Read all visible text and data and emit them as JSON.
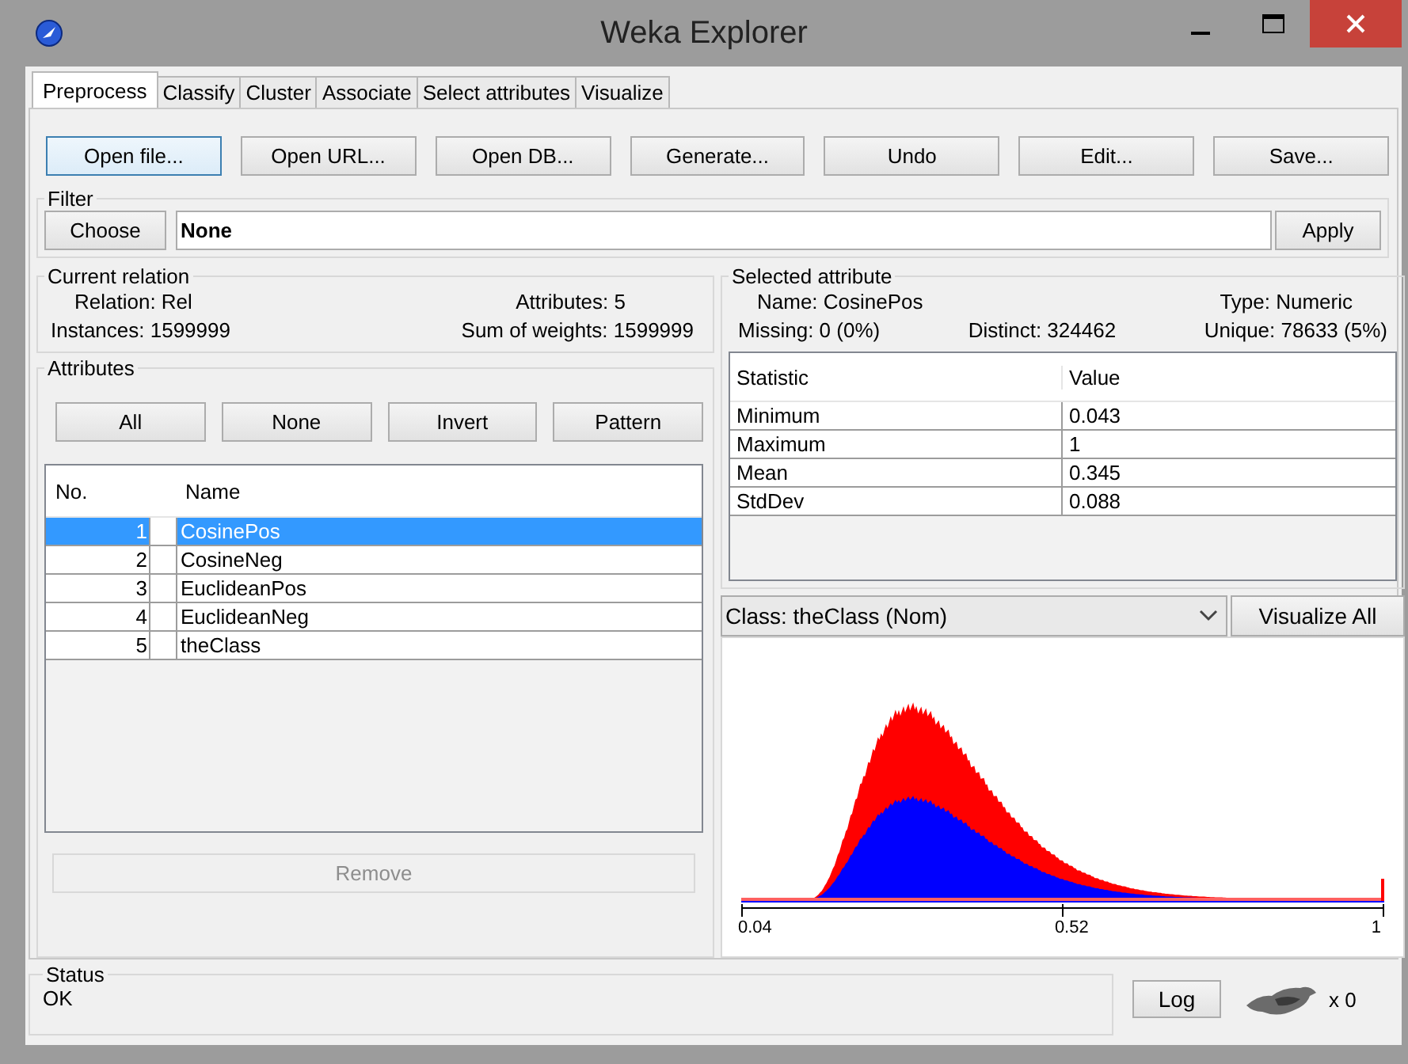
{
  "window": {
    "title": "Weka Explorer"
  },
  "tabs": [
    {
      "label": "Preprocess",
      "selected": true
    },
    {
      "label": "Classify",
      "selected": false
    },
    {
      "label": "Cluster",
      "selected": false
    },
    {
      "label": "Associate",
      "selected": false
    },
    {
      "label": "Select attributes",
      "selected": false
    },
    {
      "label": "Visualize",
      "selected": false
    }
  ],
  "toolbar": [
    {
      "label": "Open file...",
      "focused": true
    },
    {
      "label": "Open URL...",
      "focused": false
    },
    {
      "label": "Open DB...",
      "focused": false
    },
    {
      "label": "Generate...",
      "focused": false
    },
    {
      "label": "Undo",
      "focused": false
    },
    {
      "label": "Edit...",
      "focused": false
    },
    {
      "label": "Save...",
      "focused": false
    }
  ],
  "filter": {
    "title": "Filter",
    "choose": "Choose",
    "value": "None",
    "apply": "Apply"
  },
  "current_relation": {
    "title": "Current relation",
    "lines": [
      {
        "fields": [
          {
            "label": "Relation:",
            "value": "Rel"
          },
          {
            "label": "Attributes:",
            "value": "5"
          }
        ]
      },
      {
        "fields": [
          {
            "label": "Instances:",
            "value": "1599999"
          },
          {
            "label": "Sum of weights:",
            "value": "1599999"
          }
        ]
      }
    ]
  },
  "attributes": {
    "title": "Attributes",
    "buttons": [
      "All",
      "None",
      "Invert",
      "Pattern"
    ],
    "columns": [
      "No.",
      "Name"
    ],
    "rows": [
      {
        "no": "1",
        "name": "CosinePos",
        "selected": true,
        "checked": false
      },
      {
        "no": "2",
        "name": "CosineNeg",
        "selected": false,
        "checked": false
      },
      {
        "no": "3",
        "name": "EuclideanPos",
        "selected": false,
        "checked": false
      },
      {
        "no": "4",
        "name": "EuclideanNeg",
        "selected": false,
        "checked": false
      },
      {
        "no": "5",
        "name": "theClass",
        "selected": false,
        "checked": false
      }
    ],
    "remove": {
      "label": "Remove",
      "disabled": true
    }
  },
  "selected_attribute": {
    "title": "Selected attribute",
    "lines": [
      {
        "fields": [
          {
            "label": "Name:",
            "value": "CosinePos"
          },
          {
            "label": "Type:",
            "value": "Numeric"
          }
        ]
      },
      {
        "fields": [
          {
            "label": "Missing:",
            "value": "0 (0%)"
          },
          {
            "label": "Distinct:",
            "value": "324462"
          },
          {
            "label": "Unique:",
            "value": "78633 (5%)"
          }
        ]
      }
    ],
    "columns": [
      "Statistic",
      "Value"
    ],
    "stats": [
      {
        "statistic": "Minimum",
        "value": "0.043"
      },
      {
        "statistic": "Maximum",
        "value": "1"
      },
      {
        "statistic": "Mean",
        "value": "0.345"
      },
      {
        "statistic": "StdDev",
        "value": "0.088"
      }
    ]
  },
  "class_select": {
    "value": "Class: theClass (Nom)"
  },
  "visualize_all": "Visualize All",
  "histogram": {
    "ticks": [
      "0.04",
      "0.52",
      "1"
    ]
  },
  "status": {
    "title": "Status",
    "text": "OK"
  },
  "log": "Log",
  "task_count": "x 0"
}
